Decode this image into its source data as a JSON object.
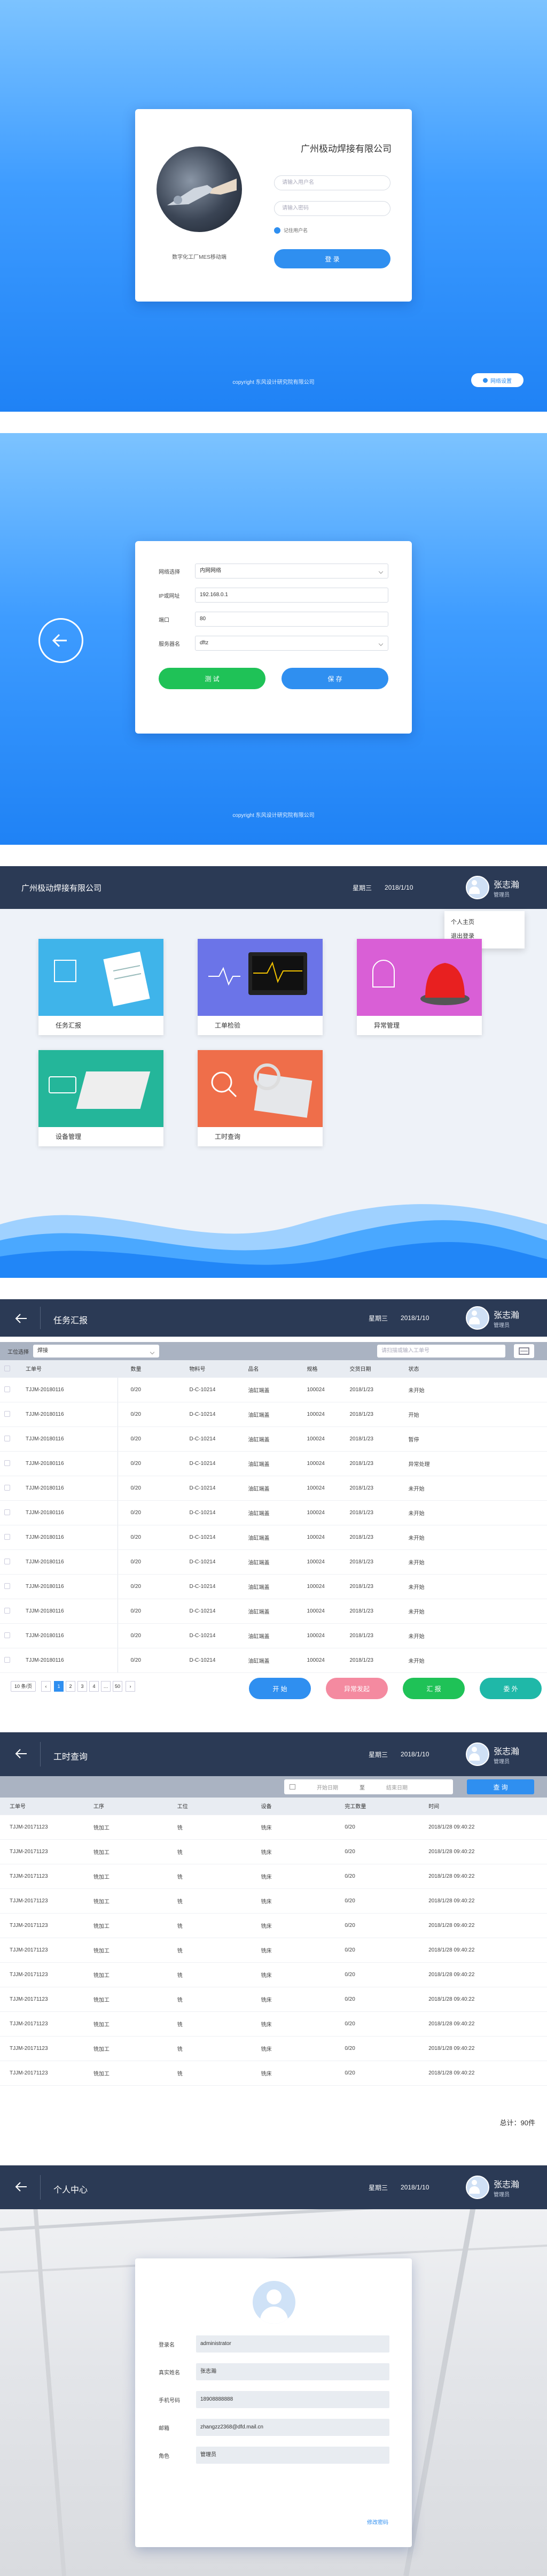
{
  "login": {
    "company": "广州极动焊接有限公司",
    "caption": "数字化工厂MES移动端",
    "user_placeholder": "请输入用户名",
    "pass_placeholder": "请输入密码",
    "remember": "记住用户名",
    "login_button": "登 录",
    "copyright": "copyright 东风设计研究院有限公司",
    "network_button": "网络设置"
  },
  "network": {
    "rows": [
      {
        "label": "网络选择",
        "value": "内网网络",
        "dropdown": true
      },
      {
        "label": "IP或网址",
        "value": "192.168.0.1",
        "dropdown": false
      },
      {
        "label": "端口",
        "value": "80",
        "dropdown": false
      },
      {
        "label": "服务器名",
        "value": "dftz",
        "dropdown": true
      }
    ],
    "test_button": "测 试",
    "save_button": "保 存",
    "copyright": "copyright 东风设计研究院有限公司"
  },
  "header": {
    "company": "广州极动焊接有限公司",
    "weekday": "星期三",
    "date": "2018/1/10",
    "user_name": "张志瀚",
    "user_role": "管理员"
  },
  "user_menu": {
    "profile": "个人主页",
    "logout": "退出登录"
  },
  "tiles": [
    {
      "label": "任务汇报",
      "color": "#3fb4ea"
    },
    {
      "label": "工单检验",
      "color": "#6b74e8"
    },
    {
      "label": "异常管理",
      "color": "#d95fd6"
    },
    {
      "label": "设备管理",
      "color": "#24b69a"
    },
    {
      "label": "工时查询",
      "color": "#ef6e4a"
    }
  ],
  "task_report": {
    "title": "任务汇报",
    "process_label": "工位选择",
    "process_value": "焊接",
    "search_placeholder": "请扫描或输入工单号",
    "columns": [
      "",
      "工单号",
      "",
      "数量",
      "物料号",
      "品名",
      "规格",
      "交货日期",
      "状态"
    ],
    "rows": [
      [
        "TJJM-20180116",
        "0/20",
        "D-C-10214",
        "油缸端盖",
        "100024",
        "2018/1/23",
        "未开始"
      ],
      [
        "TJJM-20180116",
        "0/20",
        "D-C-10214",
        "油缸端盖",
        "100024",
        "2018/1/23",
        "开始"
      ],
      [
        "TJJM-20180116",
        "0/20",
        "D-C-10214",
        "油缸端盖",
        "100024",
        "2018/1/23",
        "暂停"
      ],
      [
        "TJJM-20180116",
        "0/20",
        "D-C-10214",
        "油缸端盖",
        "100024",
        "2018/1/23",
        "异常处理"
      ],
      [
        "TJJM-20180116",
        "0/20",
        "D-C-10214",
        "油缸端盖",
        "100024",
        "2018/1/23",
        "未开始"
      ],
      [
        "TJJM-20180116",
        "0/20",
        "D-C-10214",
        "油缸端盖",
        "100024",
        "2018/1/23",
        "未开始"
      ],
      [
        "TJJM-20180116",
        "0/20",
        "D-C-10214",
        "油缸端盖",
        "100024",
        "2018/1/23",
        "未开始"
      ],
      [
        "TJJM-20180116",
        "0/20",
        "D-C-10214",
        "油缸端盖",
        "100024",
        "2018/1/23",
        "未开始"
      ],
      [
        "TJJM-20180116",
        "0/20",
        "D-C-10214",
        "油缸端盖",
        "100024",
        "2018/1/23",
        "未开始"
      ],
      [
        "TJJM-20180116",
        "0/20",
        "D-C-10214",
        "油缸端盖",
        "100024",
        "2018/1/23",
        "未开始"
      ],
      [
        "TJJM-20180116",
        "0/20",
        "D-C-10214",
        "油缸端盖",
        "100024",
        "2018/1/23",
        "未开始"
      ],
      [
        "TJJM-20180116",
        "0/20",
        "D-C-10214",
        "油缸端盖",
        "100024",
        "2018/1/23",
        "未开始"
      ]
    ],
    "page_size": "10 条/页",
    "pages": [
      "1",
      "2",
      "3",
      "4",
      "…",
      "50"
    ],
    "actions": [
      {
        "label": "开 始",
        "color": "#2f8ff0"
      },
      {
        "label": "异常发起",
        "color": "#f48aa0"
      },
      {
        "label": "汇 报",
        "color": "#1fc257"
      },
      {
        "label": "委 外",
        "color": "#1fb8a8"
      }
    ]
  },
  "hours": {
    "title": "工时查询",
    "start_placeholder": "开始日期",
    "sep": "至",
    "end_placeholder": "结束日期",
    "query_button": "查 询",
    "columns": [
      "工单号",
      "工序",
      "工位",
      "设备",
      "完工数量",
      "时间"
    ],
    "rows": [
      [
        "TJJM-20171123",
        "铣加工",
        "铣",
        "铣床",
        "0/20",
        "2018/1/28 09:40:22"
      ],
      [
        "TJJM-20171123",
        "铣加工",
        "铣",
        "铣床",
        "0/20",
        "2018/1/28 09:40:22"
      ],
      [
        "TJJM-20171123",
        "铣加工",
        "铣",
        "铣床",
        "0/20",
        "2018/1/28 09:40:22"
      ],
      [
        "TJJM-20171123",
        "铣加工",
        "铣",
        "铣床",
        "0/20",
        "2018/1/28 09:40:22"
      ],
      [
        "TJJM-20171123",
        "铣加工",
        "铣",
        "铣床",
        "0/20",
        "2018/1/28 09:40:22"
      ],
      [
        "TJJM-20171123",
        "铣加工",
        "铣",
        "铣床",
        "0/20",
        "2018/1/28 09:40:22"
      ],
      [
        "TJJM-20171123",
        "铣加工",
        "铣",
        "铣床",
        "0/20",
        "2018/1/28 09:40:22"
      ],
      [
        "TJJM-20171123",
        "铣加工",
        "铣",
        "铣床",
        "0/20",
        "2018/1/28 09:40:22"
      ],
      [
        "TJJM-20171123",
        "铣加工",
        "铣",
        "铣床",
        "0/20",
        "2018/1/28 09:40:22"
      ],
      [
        "TJJM-20171123",
        "铣加工",
        "铣",
        "铣床",
        "0/20",
        "2018/1/28 09:40:22"
      ],
      [
        "TJJM-20171123",
        "铣加工",
        "铣",
        "铣床",
        "0/20",
        "2018/1/28 09:40:22"
      ]
    ],
    "total": "总计：90件"
  },
  "profile": {
    "title": "个人中心",
    "rows": [
      {
        "label": "登录名",
        "value": "administrator"
      },
      {
        "label": "真实姓名",
        "value": "张志瀚"
      },
      {
        "label": "手机号码",
        "value": "18908888888"
      },
      {
        "label": "邮箱",
        "value": "zhangzz2368@dfd.mail.cn"
      },
      {
        "label": "角色",
        "value": "管理员"
      }
    ],
    "change_password": "修改密码"
  }
}
